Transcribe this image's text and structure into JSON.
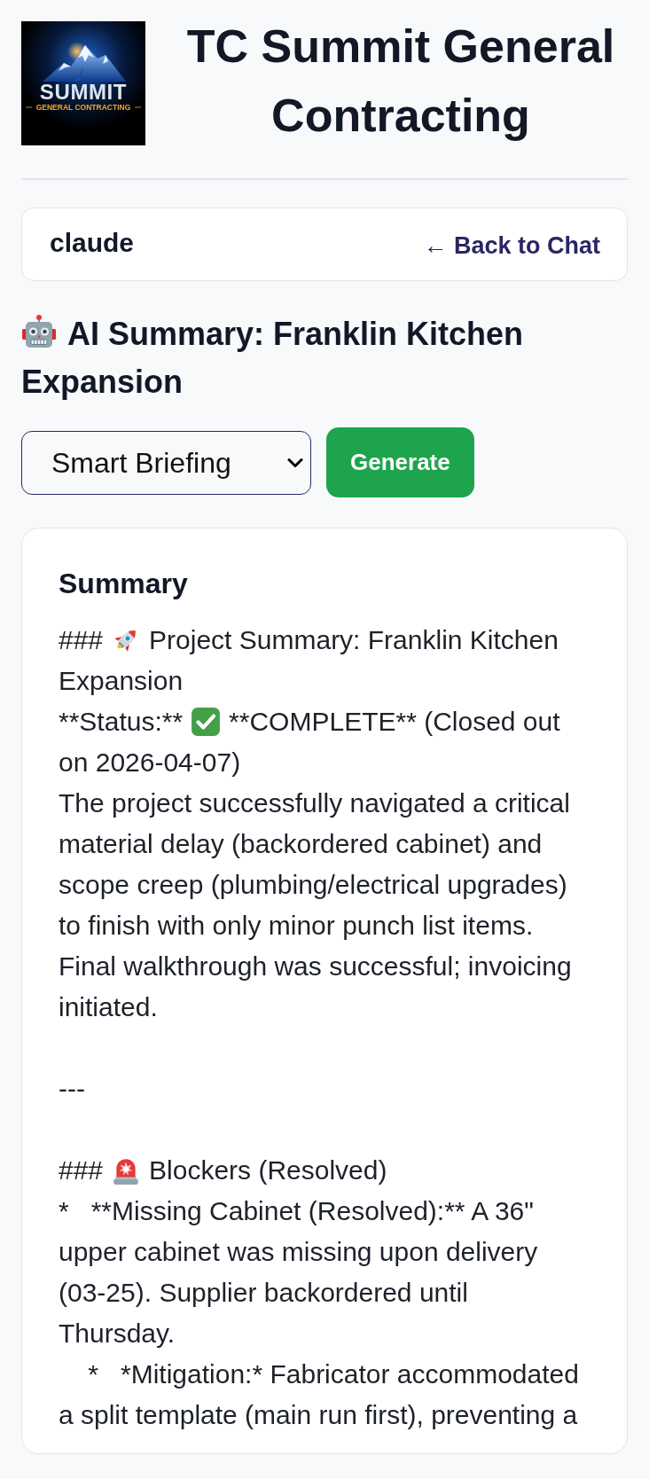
{
  "header": {
    "logo": {
      "wordmark": "SUMMIT",
      "tagline": "GENERAL CONTRACTING"
    },
    "title": "TC Summit General Contracting"
  },
  "user_bar": {
    "username": "claude",
    "back_link": "← Back to Chat"
  },
  "page_heading": {
    "lines": [
      "AI Summary: Franklin Kitchen",
      "Expansion"
    ]
  },
  "controls": {
    "summary_type": {
      "value": "Smart Briefing"
    },
    "generate_button": "Generate"
  },
  "summary": {
    "title": "Summary",
    "lines": [
      {
        "kind": "text",
        "segments": [
          {
            "kind": "text",
            "text": "###"
          },
          {
            "kind": "rocket"
          },
          {
            "kind": "text",
            "text": "Project Summary: Franklin Kitchen"
          }
        ]
      },
      {
        "kind": "text",
        "segments": [
          {
            "kind": "text",
            "text": "Expansion"
          }
        ]
      },
      {
        "kind": "text",
        "segments": [
          {
            "kind": "text",
            "text": "**Status:**"
          },
          {
            "kind": "check"
          },
          {
            "kind": "text",
            "text": "**COMPLETE** (Closed out"
          }
        ]
      },
      {
        "kind": "text",
        "segments": [
          {
            "kind": "text",
            "text": "on 2026-04-07)"
          }
        ]
      },
      {
        "kind": "text",
        "segments": [
          {
            "kind": "text",
            "text": "The project successfully navigated a critical material delay (backordered cabinet) and scope creep (plumbing/electrical upgrades) to finish with only minor punch list items. Final walkthrough was successful; invoicing initiated."
          }
        ]
      },
      {
        "kind": "blank"
      },
      {
        "kind": "text",
        "segments": [
          {
            "kind": "text",
            "text": "---"
          }
        ]
      },
      {
        "kind": "blank"
      },
      {
        "kind": "text",
        "segments": [
          {
            "kind": "text",
            "text": "###"
          },
          {
            "kind": "siren"
          },
          {
            "kind": "text",
            "text": "Blockers (Resolved)"
          }
        ]
      },
      {
        "kind": "text",
        "segments": [
          {
            "kind": "text",
            "text": "*   **Missing Cabinet (Resolved):** A 36\" upper cabinet was missing upon delivery (03-25). Supplier backordered until Thursday."
          }
        ]
      },
      {
        "kind": "text",
        "segments": [
          {
            "kind": "text",
            "text": "    *   *Mitigation:* Fabricator accommodated a split template (main run first), preventing a"
          }
        ]
      }
    ]
  }
}
